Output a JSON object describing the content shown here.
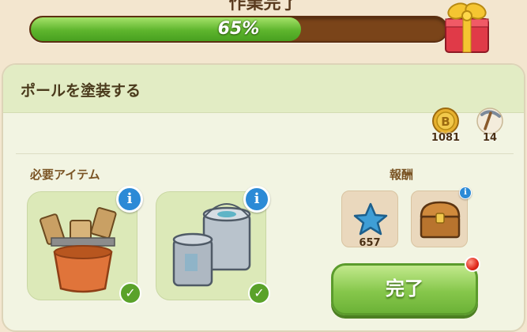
{
  "header": {
    "title": "作業完了",
    "progress_percent": 65,
    "progress_text": "65%"
  },
  "task": {
    "title": "ポールを塗装する"
  },
  "resources": [
    {
      "name": "coin",
      "amount": "1081"
    },
    {
      "name": "pickaxe",
      "amount": "14"
    }
  ],
  "required": {
    "label": "必要アイテム",
    "items": [
      {
        "name": "paint-brushes-bucket",
        "info": "i",
        "check": "✓"
      },
      {
        "name": "paint-cans",
        "info": "i",
        "check": "✓"
      }
    ]
  },
  "rewards": {
    "label": "報酬",
    "items": [
      {
        "name": "blue-star",
        "amount": "657"
      },
      {
        "name": "treasure-chest",
        "info": "i"
      }
    ]
  },
  "complete_button": {
    "label": "完了"
  },
  "colors": {
    "progress_green": "#5eb52d",
    "progress_track": "#7a4419",
    "info_blue": "#2c8ad6",
    "check_green": "#5aa22a",
    "notify_red": "#e0291c"
  }
}
